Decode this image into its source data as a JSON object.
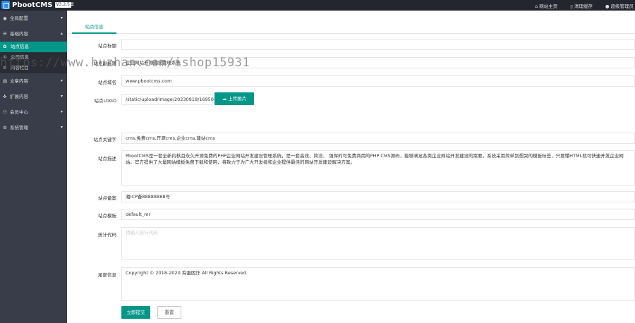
{
  "app": {
    "title": "PbootCMS",
    "version": "V3.2.5"
  },
  "topbar": {
    "links": [
      {
        "icon": "home-icon",
        "label": "网站主页"
      },
      {
        "icon": "trash-icon",
        "label": "清理缓存"
      },
      {
        "icon": "user-icon",
        "label": "超级管理员"
      }
    ]
  },
  "sidebar": {
    "items": [
      {
        "icon": "globe-icon",
        "label": "全局配置",
        "arrow": "▾"
      },
      {
        "icon": "list-icon",
        "label": "基础内容",
        "arrow": "▴"
      },
      {
        "icon": "document-icon",
        "label": "文章内容",
        "arrow": "▾"
      },
      {
        "icon": "puzzle-icon",
        "label": "扩展内容",
        "arrow": "▾"
      },
      {
        "icon": "person-icon",
        "label": "会员中心",
        "arrow": "▾"
      },
      {
        "icon": "gear-icon",
        "label": "系统管理",
        "arrow": "▾"
      }
    ],
    "subitems": [
      {
        "icon": "settings-icon",
        "label": "站点信息"
      },
      {
        "icon": "copyright-icon",
        "label": "公司信息"
      },
      {
        "icon": "menu-icon",
        "label": "内容栏目"
      }
    ]
  },
  "tab": {
    "label": "站点信息"
  },
  "form": {
    "site_title": {
      "label": "站点标题",
      "value": ""
    },
    "subtitle": {
      "label": "站点副标题",
      "value": "企业网站开源建设管理系统"
    },
    "domain": {
      "label": "站点域名",
      "value": "www.pbootcms.com"
    },
    "logo": {
      "label": "站点LOGO",
      "value": "/static/upload/image/20230918/1695048",
      "upload_label": "上传图片"
    },
    "keywords": {
      "label": "站点关键字",
      "value": "cms,免费cms,开源cms,企业cms,建站cms"
    },
    "description": {
      "label": "站点描述",
      "value": "PbootCMS是一套全新内核且永久开源免费的PHP企业网站开发建设管理系统，是一套高效、简洁、 强悍的可免费商用的PHP CMS源码，能够满足各类企业网站开发建设的需要。系统采用简单到想哭的模板标签，只要懂HTML就可快速开发企业网站。官方提供了大量网站模板免费下载和使用，将致力于为广大开发者和企业提供最佳的网站开发建设解决方案。"
    },
    "icp": {
      "label": "站点备案",
      "value": "湘ICP备88888888号"
    },
    "template": {
      "label": "站点模板",
      "value": "default_mr"
    },
    "stats": {
      "label": "统计代码",
      "placeholder": "请输入统计代码"
    },
    "footer": {
      "label": "尾部信息",
      "value": "Copyright © 2018-2020 捣蛋困诈 All Rights Reserved."
    },
    "submit_label": "立即提交",
    "reset_label": "重置"
  },
  "watermark": "https://www.huzhan.com/ishop15931"
}
